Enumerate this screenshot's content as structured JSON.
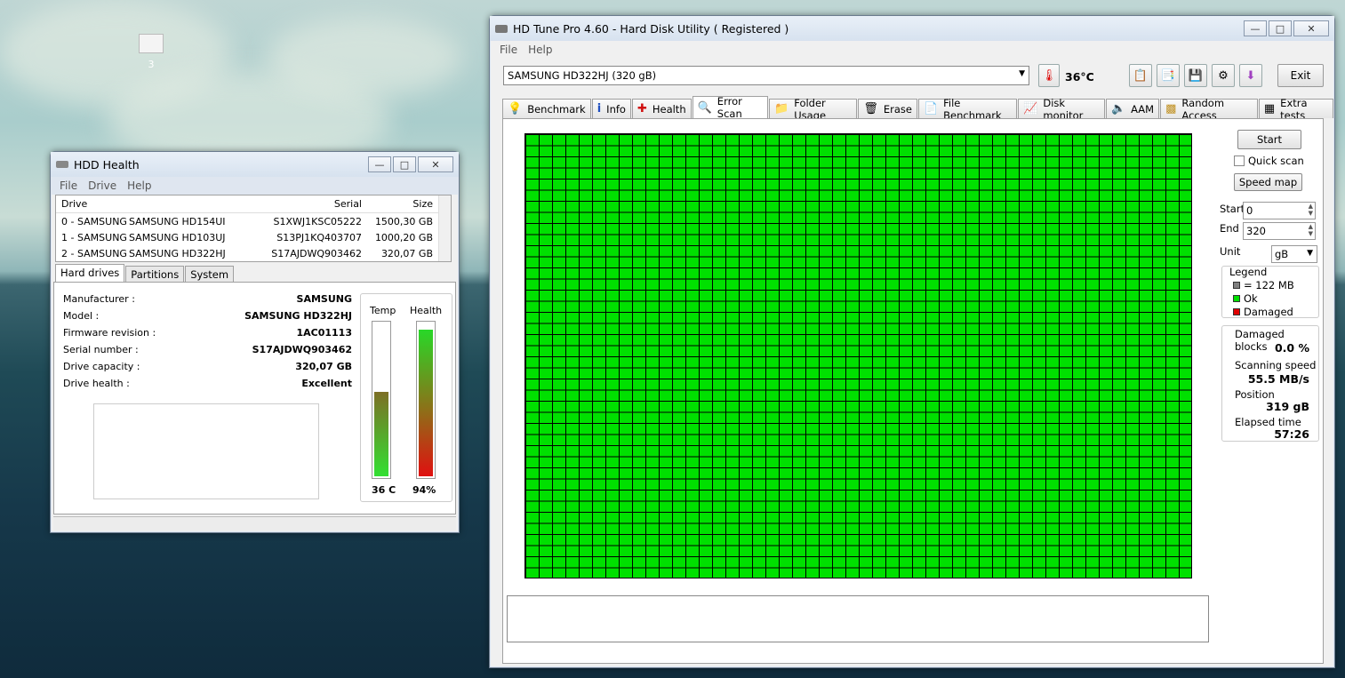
{
  "desktop": {
    "icon_label": "3"
  },
  "hddhealth": {
    "title": "HDD Health",
    "menu": [
      "File",
      "Drive",
      "Help"
    ],
    "columns": {
      "drive": "Drive",
      "serial": "Serial",
      "size": "Size"
    },
    "drives": [
      {
        "id": "0 - SAMSUNG",
        "model": "SAMSUNG HD154UI",
        "serial": "S1XWJ1KSC05222",
        "size": "1500,30 GB"
      },
      {
        "id": "1 - SAMSUNG",
        "model": "SAMSUNG HD103UJ",
        "serial": "S13PJ1KQ403707",
        "size": "1000,20 GB"
      },
      {
        "id": "2 - SAMSUNG",
        "model": "SAMSUNG HD322HJ",
        "serial": "S17AJDWQ903462",
        "size": "320,07 GB"
      }
    ],
    "tabs": [
      "Hard drives",
      "Partitions",
      "System"
    ],
    "info": [
      {
        "k": "Manufacturer :",
        "v": "SAMSUNG"
      },
      {
        "k": "Model :",
        "v": "SAMSUNG HD322HJ"
      },
      {
        "k": "Firmware revision :",
        "v": "1AC01113"
      },
      {
        "k": "Serial number :",
        "v": "S17AJDWQ903462"
      },
      {
        "k": "Drive capacity :",
        "v": "320,07 GB"
      },
      {
        "k": "Drive health :",
        "v": "Excellent"
      }
    ],
    "gauges": {
      "temp_label": "Temp",
      "health_label": "Health",
      "temp_value": "36 C",
      "health_value": "94%",
      "temp_level": 0.54,
      "health_level": 0.94
    }
  },
  "hdtune": {
    "title": "HD Tune Pro 4.60 - Hard Disk Utility (  Registered )",
    "menu": [
      "File",
      "Help"
    ],
    "drive": "SAMSUNG HD322HJ (320 gB)",
    "temperature": "36°C",
    "exit_label": "Exit",
    "tabs": [
      {
        "label": "Benchmark",
        "icon": "lightbulb-icon"
      },
      {
        "label": "Info",
        "icon": "info-icon"
      },
      {
        "label": "Health",
        "icon": "health-cross-icon"
      },
      {
        "label": "Error Scan",
        "icon": "magnifier-icon"
      },
      {
        "label": "Folder Usage",
        "icon": "folder-icon"
      },
      {
        "label": "Erase",
        "icon": "trash-icon"
      },
      {
        "label": "File Benchmark",
        "icon": "file-benchmark-icon"
      },
      {
        "label": "Disk monitor",
        "icon": "disk-monitor-icon"
      },
      {
        "label": "AAM",
        "icon": "speaker-icon"
      },
      {
        "label": "Random Access",
        "icon": "random-access-icon"
      },
      {
        "label": "Extra tests",
        "icon": "extra-tests-icon"
      }
    ],
    "selected_tab": "Error Scan",
    "controls": {
      "start_button": "Start",
      "quick_scan": "Quick scan",
      "quick_scan_checked": false,
      "speed_map": "Speed map",
      "start_label": "Start",
      "start_value": "0",
      "end_label": "End",
      "end_value": "320",
      "unit_label": "Unit",
      "unit_value": "gB"
    },
    "legend": {
      "title": "Legend",
      "block": "= 122 MB",
      "ok": "Ok",
      "damaged": "Damaged",
      "block_color": "#808080",
      "ok_color": "#00e000",
      "damaged_color": "#e00000"
    },
    "stats": {
      "damaged_label": "Damaged blocks",
      "damaged_value": "0.0 %",
      "speed_label": "Scanning speed",
      "speed_value": "55.5 MB/s",
      "position_label": "Position",
      "position_value": "319 gB",
      "elapsed_label": "Elapsed time",
      "elapsed_value": "57:26"
    }
  }
}
